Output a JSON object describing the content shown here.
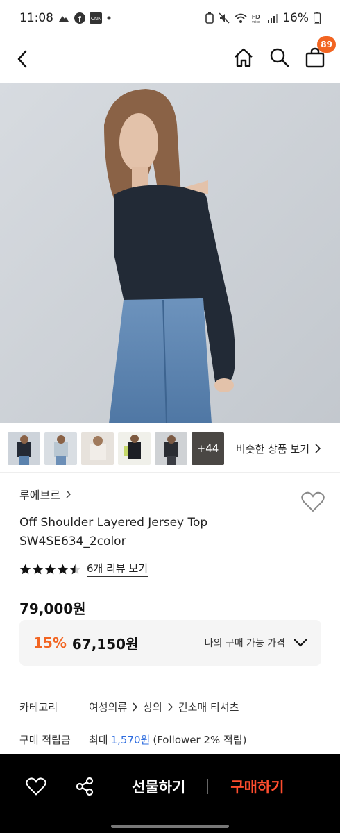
{
  "status": {
    "time": "11:08",
    "battery": "16%"
  },
  "header": {
    "cart_count": "89"
  },
  "thumbnails": {
    "more_label": "+44",
    "similar_label": "비슷한 상품 보기"
  },
  "product": {
    "brand": "루에브르",
    "title_line1": "Off Shoulder Layered Jersey Top",
    "title_line2": "SW4SE634_2color",
    "rating": 4.5,
    "review_link": "6개 리뷰 보기",
    "price": "79,000원"
  },
  "my_price": {
    "discount": "15%",
    "discounted_price": "67,150원",
    "label": "나의 구매 가능 가격"
  },
  "category": {
    "label": "카테고리",
    "path": [
      "여성의류",
      "상의",
      "긴소매 티셔츠"
    ]
  },
  "points": {
    "label": "구매 적립금",
    "prefix": "최대",
    "amount": "1,570원",
    "suffix": "(Follower 2% 적립)"
  },
  "bottom": {
    "gift_label": "선물하기",
    "buy_label": "구매하기"
  },
  "colors": {
    "accent": "#f26522",
    "buy": "#ff4d2e",
    "link_blue": "#2d6cdf"
  }
}
